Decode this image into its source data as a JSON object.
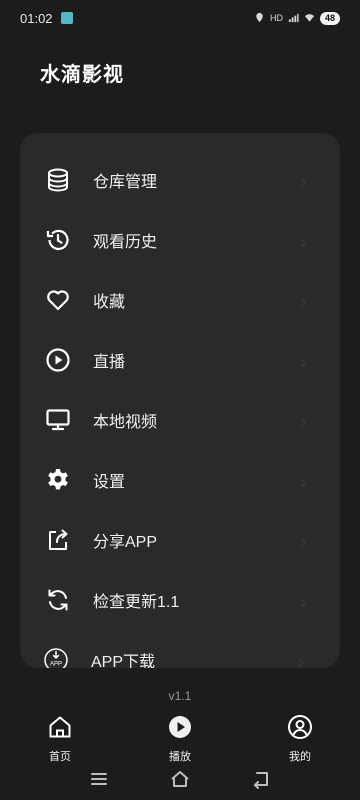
{
  "status_bar": {
    "time": "01:02",
    "battery": "48",
    "signal_text": "HD"
  },
  "app_title": "水滴影视",
  "menu": {
    "items": [
      {
        "label": "仓库管理",
        "icon": "database-icon"
      },
      {
        "label": "观看历史",
        "icon": "history-icon"
      },
      {
        "label": "收藏",
        "icon": "heart-icon"
      },
      {
        "label": "直播",
        "icon": "play-circle-icon"
      },
      {
        "label": "本地视频",
        "icon": "monitor-icon"
      },
      {
        "label": "设置",
        "icon": "gear-icon"
      },
      {
        "label": "分享APP",
        "icon": "share-icon"
      },
      {
        "label": "检查更新1.1",
        "icon": "refresh-icon"
      },
      {
        "label": "APP下载",
        "icon": "app-download-icon"
      }
    ]
  },
  "version": "v1.1",
  "tabs": [
    {
      "label": "首页",
      "icon": "home-icon"
    },
    {
      "label": "播放",
      "icon": "play-icon"
    },
    {
      "label": "我的",
      "icon": "user-icon"
    }
  ],
  "system_nav": {
    "icons": [
      "menu-icon",
      "home-outline-icon",
      "back-icon"
    ]
  },
  "colors": {
    "background": "#1c1c1c",
    "card": "#2a2a2a",
    "text": "#f0f0f0",
    "muted": "#9a9a9a"
  }
}
